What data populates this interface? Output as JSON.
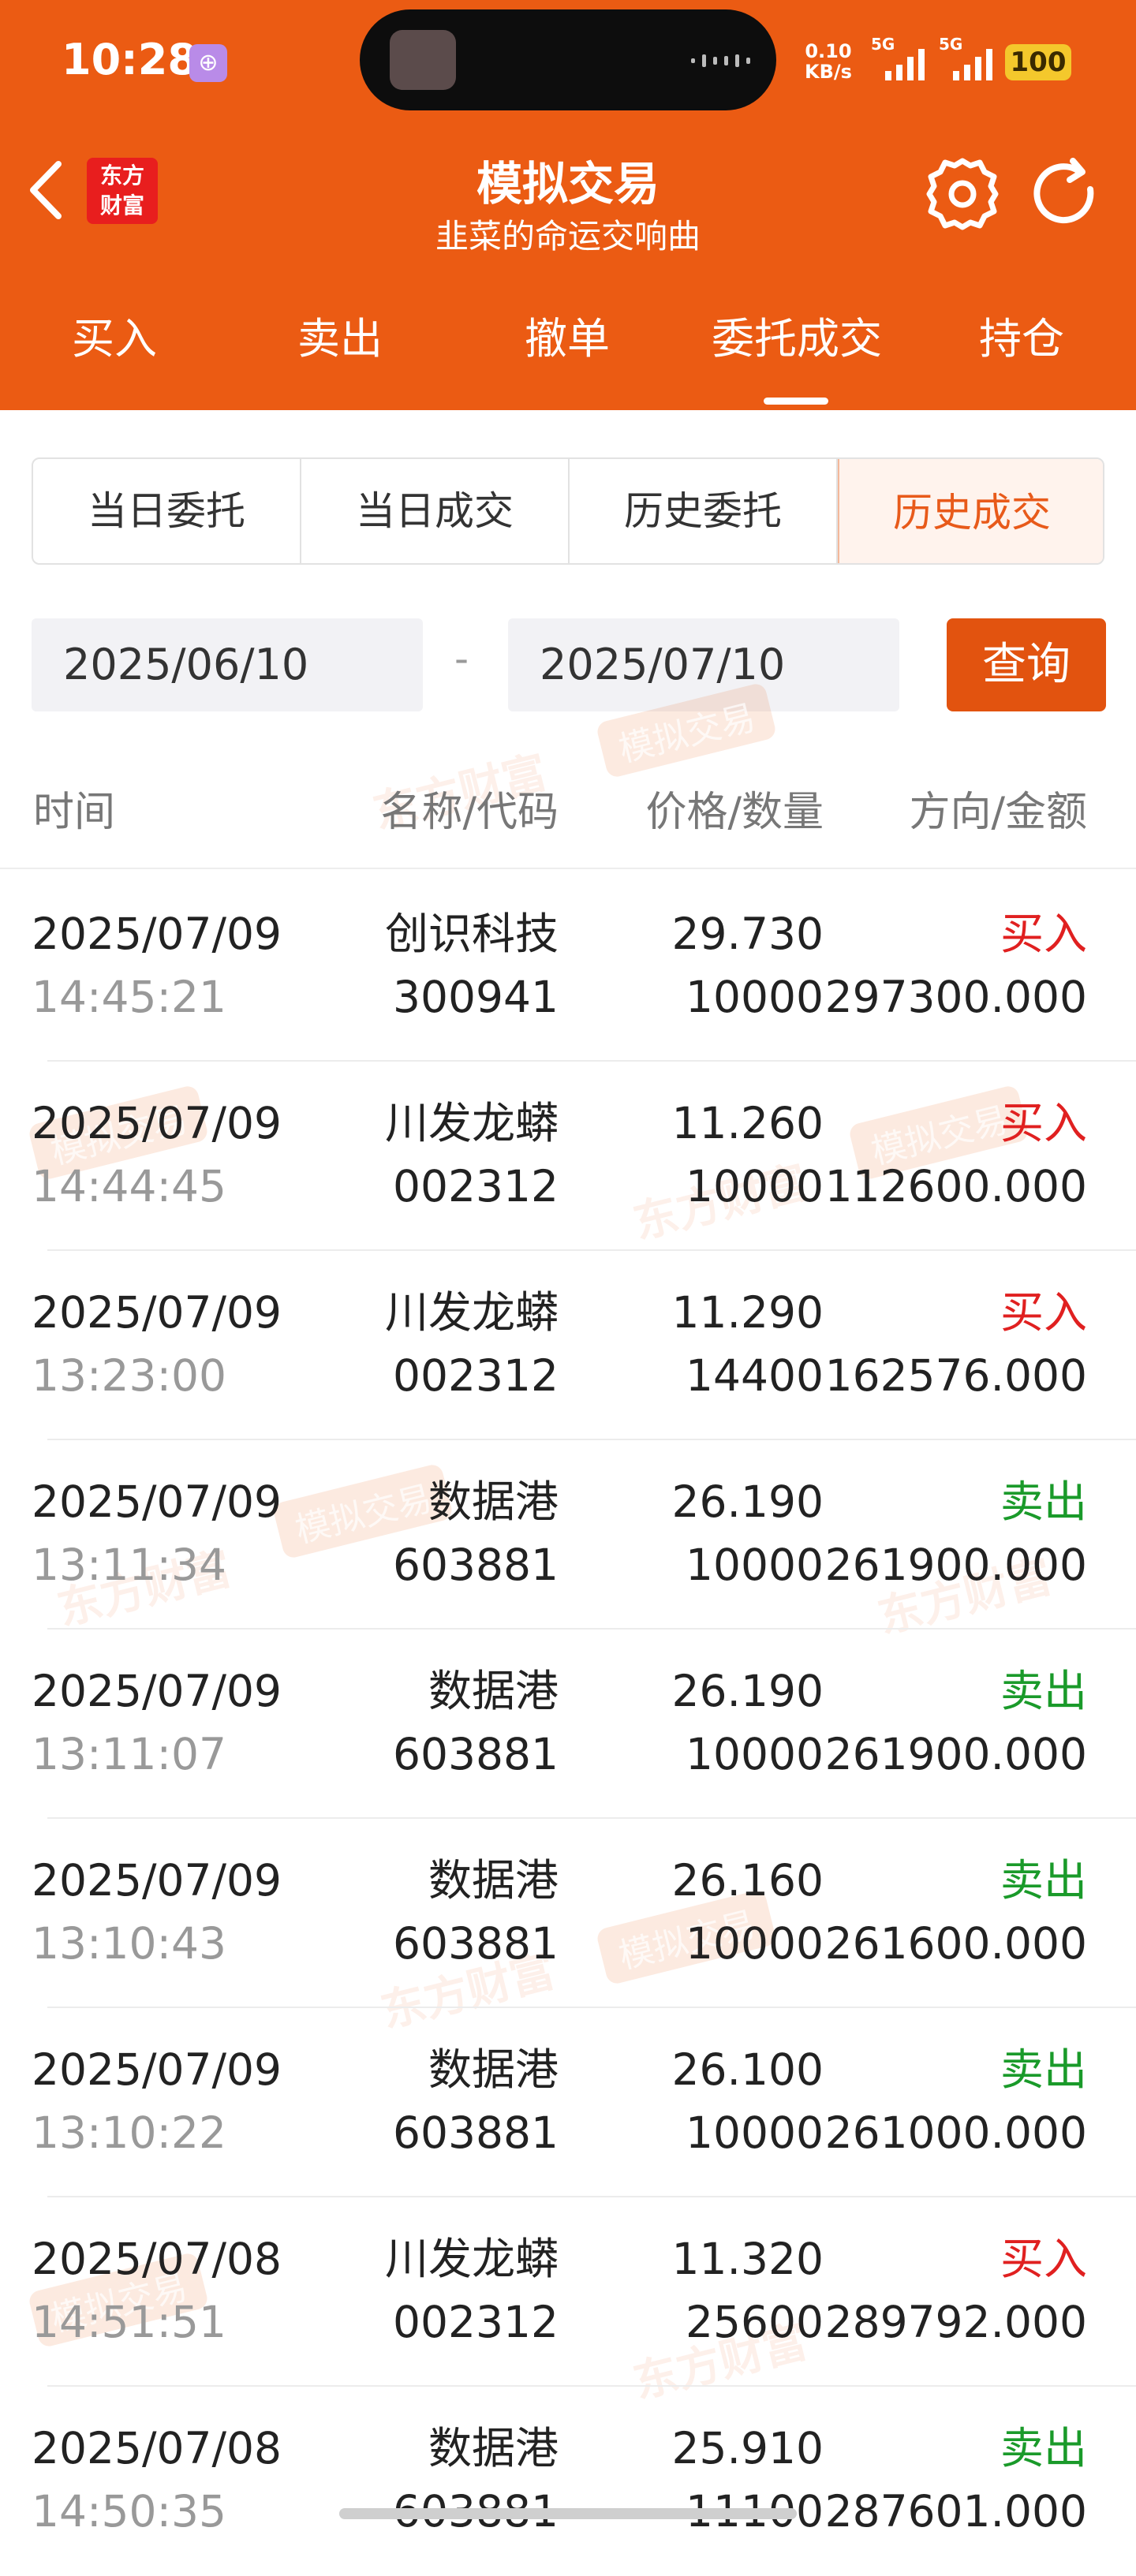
{
  "status_bar": {
    "time": "10:28",
    "net_speed_value": "0.10",
    "net_speed_unit": "KB/s",
    "signal1": "5G",
    "signal2": "5G",
    "battery": "100"
  },
  "header": {
    "logo_line1": "东方",
    "logo_line2": "财富",
    "title": "模拟交易",
    "subtitle": "韭菜的命运交响曲"
  },
  "tabs": [
    "买入",
    "卖出",
    "撤单",
    "委托成交",
    "持仓"
  ],
  "active_tab": "委托成交",
  "segments": [
    "当日委托",
    "当日成交",
    "历史委托",
    "历史成交"
  ],
  "active_segment": "历史成交",
  "date_range": {
    "start": "2025/06/10",
    "separator": "-",
    "end": "2025/07/10",
    "query_label": "查询"
  },
  "table": {
    "headers": [
      "时间",
      "名称/代码",
      "价格/数量",
      "方向/金额"
    ],
    "rows": [
      {
        "date": "2025/07/09",
        "time": "14:45:21",
        "name": "创识科技",
        "code": "300941",
        "price": "29.730",
        "qty": "10000",
        "direction": "买入",
        "amount": "297300.000"
      },
      {
        "date": "2025/07/09",
        "time": "14:44:45",
        "name": "川发龙蟒",
        "code": "002312",
        "price": "11.260",
        "qty": "10000",
        "direction": "买入",
        "amount": "112600.000"
      },
      {
        "date": "2025/07/09",
        "time": "13:23:00",
        "name": "川发龙蟒",
        "code": "002312",
        "price": "11.290",
        "qty": "14400",
        "direction": "买入",
        "amount": "162576.000"
      },
      {
        "date": "2025/07/09",
        "time": "13:11:34",
        "name": "数据港",
        "code": "603881",
        "price": "26.190",
        "qty": "10000",
        "direction": "卖出",
        "amount": "261900.000"
      },
      {
        "date": "2025/07/09",
        "time": "13:11:07",
        "name": "数据港",
        "code": "603881",
        "price": "26.190",
        "qty": "10000",
        "direction": "卖出",
        "amount": "261900.000"
      },
      {
        "date": "2025/07/09",
        "time": "13:10:43",
        "name": "数据港",
        "code": "603881",
        "price": "26.160",
        "qty": "10000",
        "direction": "卖出",
        "amount": "261600.000"
      },
      {
        "date": "2025/07/09",
        "time": "13:10:22",
        "name": "数据港",
        "code": "603881",
        "price": "26.100",
        "qty": "10000",
        "direction": "卖出",
        "amount": "261000.000"
      },
      {
        "date": "2025/07/08",
        "time": "14:51:51",
        "name": "川发龙蟒",
        "code": "002312",
        "price": "11.320",
        "qty": "25600",
        "direction": "买入",
        "amount": "289792.000"
      },
      {
        "date": "2025/07/08",
        "time": "14:50:35",
        "name": "数据港",
        "code": "603881",
        "price": "25.910",
        "qty": "11100",
        "direction": "卖出",
        "amount": "287601.000"
      }
    ]
  },
  "watermark": {
    "brand": "东方财富",
    "badge": "模拟交易"
  },
  "colors": {
    "brand_orange": "#eb5b13",
    "buy_red": "#e02020",
    "sell_green": "#1a9a2a"
  }
}
